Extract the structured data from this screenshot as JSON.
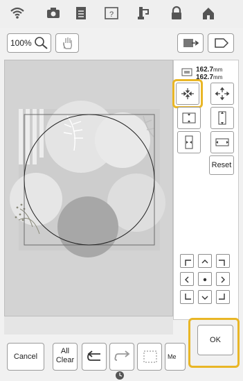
{
  "toolbar": {
    "zoom_label": "100%"
  },
  "size": {
    "width": "162.7",
    "height": "162.7",
    "unit": "mm"
  },
  "panel": {
    "reset_label": "Reset"
  },
  "bottom": {
    "cancel_label": "Cancel",
    "all_clear_label_1": "All",
    "all_clear_label_2": "Clear",
    "memory_label": "Me",
    "ok_label": "OK"
  },
  "colors": {
    "highlight": "#e9b626",
    "canvas_bg": "#d3d3d3",
    "circle_dark": "#a6a6a6",
    "circle_light": "#e7e7e7"
  },
  "icons": [
    "wifi-icon",
    "camera-icon",
    "document-icon",
    "help-icon",
    "embroidery-icon",
    "lock-icon",
    "home-icon"
  ]
}
